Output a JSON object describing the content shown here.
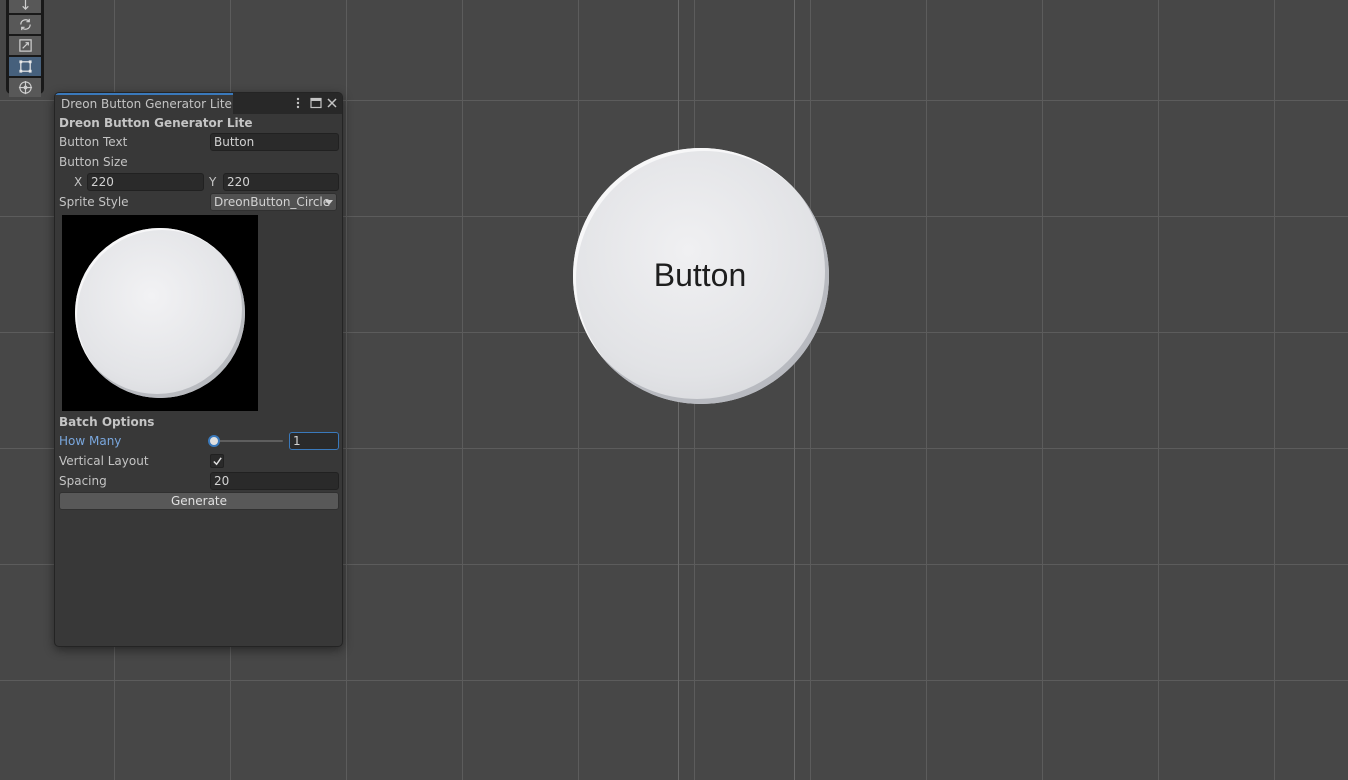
{
  "window": {
    "tab_title": "Dreon Button Generator Lite",
    "heading": "Dreon Button Generator Lite",
    "button_text_label": "Button Text",
    "button_text_value": "Button",
    "button_size_label": "Button Size",
    "size_x_label": "X",
    "size_x_value": "220",
    "size_y_label": "Y",
    "size_y_value": "220",
    "sprite_style_label": "Sprite Style",
    "sprite_style_value": "DreonButton_Circle",
    "batch_heading": "Batch Options",
    "how_many_label": "How Many",
    "how_many_value": "1",
    "vertical_layout_label": "Vertical Layout",
    "vertical_layout_checked": true,
    "spacing_label": "Spacing",
    "spacing_value": "20",
    "generate_label": "Generate",
    "controls": [
      "more-options-icon",
      "maximize-icon",
      "close-icon"
    ]
  },
  "toolbar": {
    "tools": [
      "move-tool-icon",
      "rotate-tool-icon",
      "scale-tool-icon",
      "rect-tool-icon",
      "transform-tool-icon"
    ],
    "active_tool": "rect-tool-icon"
  },
  "scene": {
    "button_label": "Button"
  },
  "colors": {
    "accent": "#3a79bb",
    "scene_bg": "#474747",
    "panel_bg": "#383838"
  }
}
